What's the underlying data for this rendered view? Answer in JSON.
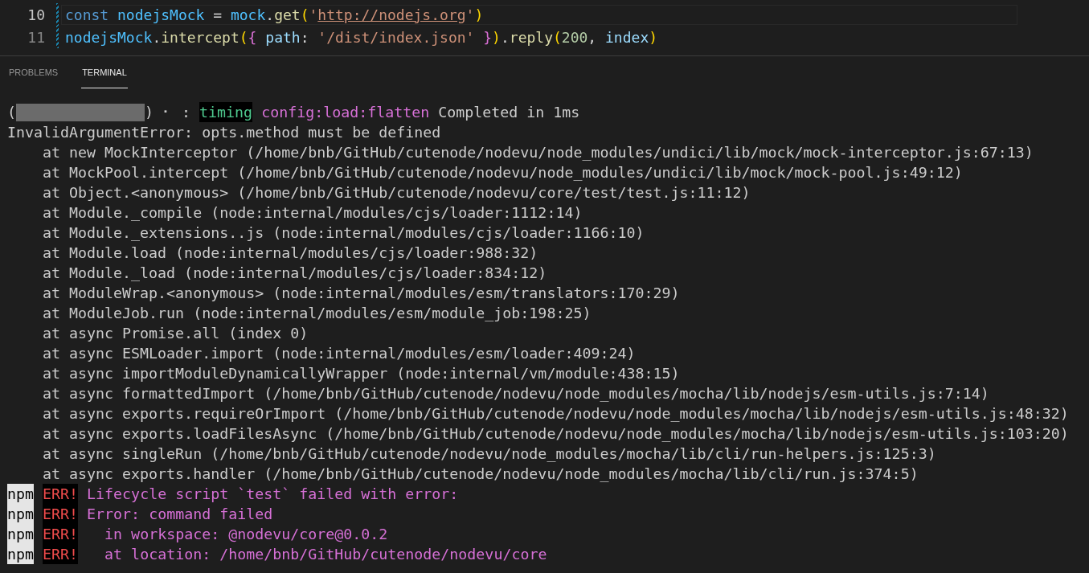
{
  "editor": {
    "lines": [
      {
        "number": "10",
        "current": true,
        "tokens": [
          {
            "text": "const ",
            "kind": "keyword"
          },
          {
            "text": "nodejsMock",
            "kind": "constant"
          },
          {
            "text": " = ",
            "kind": "plain"
          },
          {
            "text": "mock",
            "kind": "constant"
          },
          {
            "text": ".",
            "kind": "plain"
          },
          {
            "text": "get",
            "kind": "function"
          },
          {
            "text": "(",
            "kind": "bracket1"
          },
          {
            "text": "'",
            "kind": "string"
          },
          {
            "text": "http://nodejs.org",
            "kind": "link"
          },
          {
            "text": "'",
            "kind": "string"
          },
          {
            "text": ")",
            "kind": "bracket1"
          }
        ]
      },
      {
        "number": "11",
        "current": false,
        "tokens": [
          {
            "text": "nodejsMock",
            "kind": "constant"
          },
          {
            "text": ".",
            "kind": "plain"
          },
          {
            "text": "intercept",
            "kind": "function"
          },
          {
            "text": "(",
            "kind": "bracket1"
          },
          {
            "text": "{ ",
            "kind": "bracket2"
          },
          {
            "text": "path",
            "kind": "property"
          },
          {
            "text": ": ",
            "kind": "plain"
          },
          {
            "text": "'/dist/index.json'",
            "kind": "string"
          },
          {
            "text": " }",
            "kind": "bracket2"
          },
          {
            "text": ")",
            "kind": "bracket1"
          },
          {
            "text": ".",
            "kind": "plain"
          },
          {
            "text": "reply",
            "kind": "function"
          },
          {
            "text": "(",
            "kind": "bracket1"
          },
          {
            "text": "200",
            "kind": "number"
          },
          {
            "text": ", ",
            "kind": "plain"
          },
          {
            "text": "index",
            "kind": "property"
          },
          {
            "text": ")",
            "kind": "bracket1"
          }
        ]
      }
    ]
  },
  "panel_tabs": [
    {
      "label": "PROBLEMS",
      "selected": false
    },
    {
      "label": "TERMINAL",
      "selected": true
    }
  ],
  "terminal": {
    "lines": [
      {
        "kind": "log",
        "open": "(",
        "close": ") ⠂ :",
        "tag": "timing",
        "topic": "config:load:flatten",
        "message": "Completed in 1ms"
      },
      {
        "kind": "plain",
        "text": "InvalidArgumentError: opts.method must be defined"
      },
      {
        "kind": "plain",
        "text": "    at new MockInterceptor (/home/bnb/GitHub/cutenode/nodevu/node_modules/undici/lib/mock/mock-interceptor.js:67:13)"
      },
      {
        "kind": "plain",
        "text": "    at MockPool.intercept (/home/bnb/GitHub/cutenode/nodevu/node_modules/undici/lib/mock/mock-pool.js:49:12)"
      },
      {
        "kind": "plain",
        "text": "    at Object.<anonymous> (/home/bnb/GitHub/cutenode/nodevu/core/test/test.js:11:12)"
      },
      {
        "kind": "plain",
        "text": "    at Module._compile (node:internal/modules/cjs/loader:1112:14)"
      },
      {
        "kind": "plain",
        "text": "    at Module._extensions..js (node:internal/modules/cjs/loader:1166:10)"
      },
      {
        "kind": "plain",
        "text": "    at Module.load (node:internal/modules/cjs/loader:988:32)"
      },
      {
        "kind": "plain",
        "text": "    at Module._load (node:internal/modules/cjs/loader:834:12)"
      },
      {
        "kind": "plain",
        "text": "    at ModuleWrap.<anonymous> (node:internal/modules/esm/translators:170:29)"
      },
      {
        "kind": "plain",
        "text": "    at ModuleJob.run (node:internal/modules/esm/module_job:198:25)"
      },
      {
        "kind": "plain",
        "text": "    at async Promise.all (index 0)"
      },
      {
        "kind": "plain",
        "text": "    at async ESMLoader.import (node:internal/modules/esm/loader:409:24)"
      },
      {
        "kind": "plain",
        "text": "    at async importModuleDynamicallyWrapper (node:internal/vm/module:438:15)"
      },
      {
        "kind": "plain",
        "text": "    at async formattedImport (/home/bnb/GitHub/cutenode/nodevu/node_modules/mocha/lib/nodejs/esm-utils.js:7:14)"
      },
      {
        "kind": "plain",
        "text": "    at async exports.requireOrImport (/home/bnb/GitHub/cutenode/nodevu/node_modules/mocha/lib/nodejs/esm-utils.js:48:32)"
      },
      {
        "kind": "plain",
        "text": "    at async exports.loadFilesAsync (/home/bnb/GitHub/cutenode/nodevu/node_modules/mocha/lib/nodejs/esm-utils.js:103:20)"
      },
      {
        "kind": "plain",
        "text": "    at async singleRun (/home/bnb/GitHub/cutenode/nodevu/node_modules/mocha/lib/cli/run-helpers.js:125:3)"
      },
      {
        "kind": "plain",
        "text": "    at async exports.handler (/home/bnb/GitHub/cutenode/nodevu/node_modules/mocha/lib/cli/run.js:374:5)"
      },
      {
        "kind": "npm",
        "prefix": "npm",
        "level": "ERR!",
        "message": "Lifecycle script `test` failed with error:"
      },
      {
        "kind": "npm",
        "prefix": "npm",
        "level": "ERR!",
        "message": "Error: command failed"
      },
      {
        "kind": "npm",
        "prefix": "npm",
        "level": "ERR!",
        "message": "  in workspace: @nodevu/core@0.0.2"
      },
      {
        "kind": "npm",
        "prefix": "npm",
        "level": "ERR!",
        "message": "  at location: /home/bnb/GitHub/cutenode/nodevu/core"
      }
    ]
  }
}
